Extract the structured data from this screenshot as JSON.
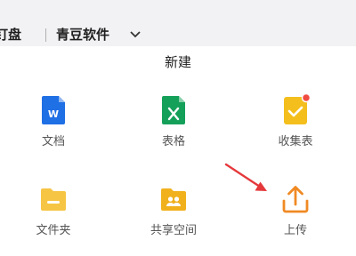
{
  "header": {
    "breadcrumb_1": "钉盘",
    "breadcrumb_2": "青豆软件"
  },
  "sheet": {
    "title": "新建",
    "items": [
      {
        "label": "文档",
        "icon": "word-doc-icon",
        "color": "#1f6fe5"
      },
      {
        "label": "表格",
        "icon": "excel-sheet-icon",
        "color": "#15a05a"
      },
      {
        "label": "收集表",
        "icon": "form-collect-icon",
        "color": "#f4bf1d"
      },
      {
        "label": "文件夹",
        "icon": "folder-icon",
        "color": "#f6c544"
      },
      {
        "label": "共享空间",
        "icon": "shared-space-icon",
        "color": "#f1b11d"
      },
      {
        "label": "上传",
        "icon": "upload-icon",
        "color": "#f08a24"
      }
    ]
  },
  "colors": {
    "annotation_arrow": "#e5383b",
    "badge": "#f04b41"
  }
}
